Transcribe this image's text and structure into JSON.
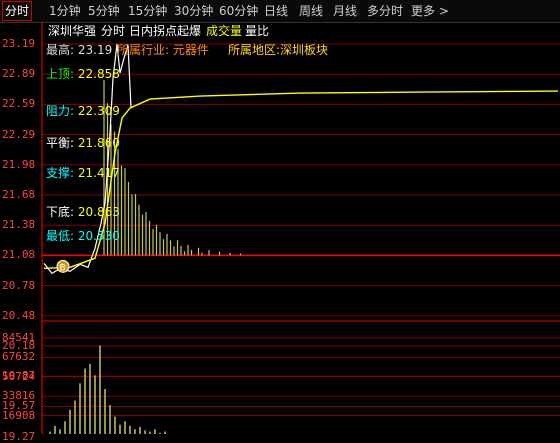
{
  "tabs": [
    {
      "label": "分时",
      "active": true
    },
    {
      "label": "1分钟"
    },
    {
      "label": "5分钟"
    },
    {
      "label": "15分钟"
    },
    {
      "label": "30分钟"
    },
    {
      "label": "60分钟"
    },
    {
      "label": "日线"
    },
    {
      "label": "周线"
    },
    {
      "label": "月线"
    },
    {
      "label": "多分时"
    },
    {
      "label": "更多"
    }
  ],
  "header": {
    "stock_name": "深圳华强",
    "view": "分时",
    "indicator": "日内拐点起爆",
    "volume_label": "成交量",
    "ratio_label": "量比"
  },
  "price_axis": [
    "23.19",
    "22.89",
    "22.59",
    "22.29",
    "21.98",
    "21.68",
    "21.38",
    "21.08",
    "20.78",
    "20.48",
    "20.18",
    "19.87",
    "19.57",
    "19.27"
  ],
  "volume_axis": [
    "84541",
    "67632",
    "50724",
    "33816",
    "16908"
  ],
  "info": {
    "high": {
      "label": "最高:",
      "value": "23.19"
    },
    "industry": {
      "label": "所属行业:",
      "value": "元器件"
    },
    "region": {
      "label": "所属地区:",
      "value": "深圳板块"
    },
    "top": {
      "label": "上顶:",
      "value": "22.858"
    },
    "resistance": {
      "label": "阻力:",
      "value": "22.309"
    },
    "balance": {
      "label": "平衡:",
      "value": "21.860"
    },
    "support": {
      "label": "支撑:",
      "value": "21.417"
    },
    "bottom": {
      "label": "下底:",
      "value": "20.863"
    },
    "low": {
      "label": "最低:",
      "value": "20.530"
    }
  },
  "buy_marker": "B",
  "colors": {
    "grid": "#8b0000",
    "axis": "#ff4444",
    "price_line": "#ffffff",
    "avg_line": "#ffff00",
    "bars": "#c8c850",
    "accent": "#ff0000"
  }
}
